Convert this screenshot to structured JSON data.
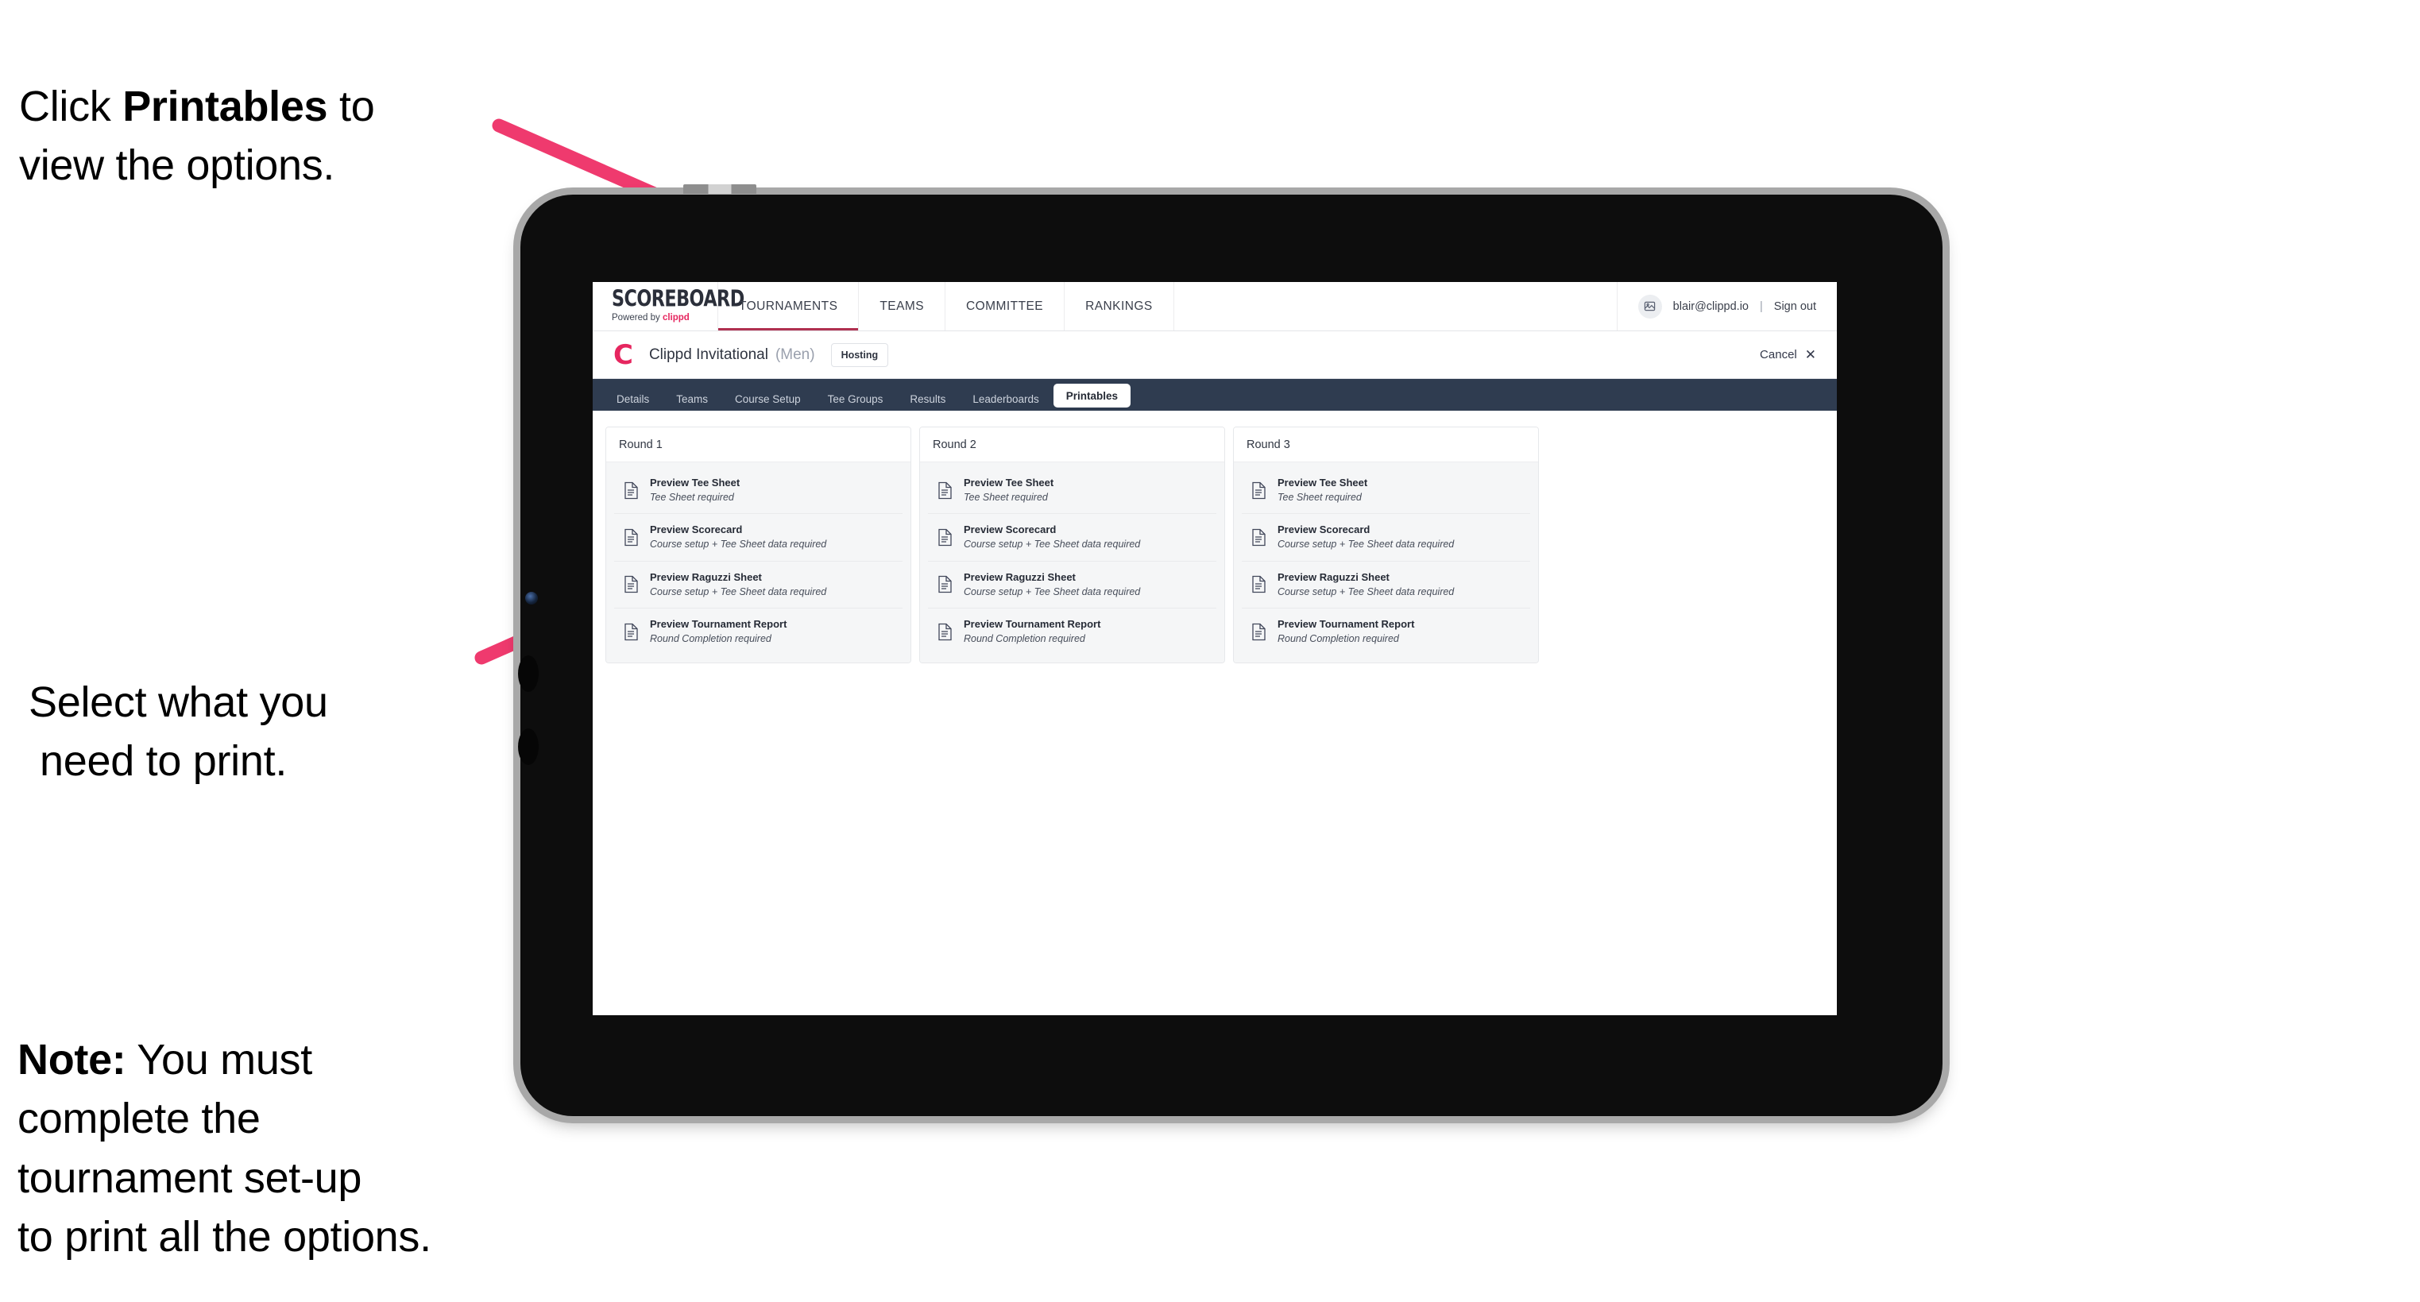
{
  "annotations": {
    "top": {
      "pre": "Click ",
      "bold": "Printables",
      "post": " to\nview the options."
    },
    "middle": {
      "line1": "Select what you",
      "line2": "need to print."
    },
    "note": {
      "bold": "Note:",
      "rest": " You must\ncomplete the\ntournament set-up\nto print all the options."
    }
  },
  "app": {
    "brand": {
      "title": "SCOREBOARD",
      "powered_by": "Powered by ",
      "powered_brand": "clippd"
    },
    "nav": [
      {
        "label": "TOURNAMENTS",
        "active": true
      },
      {
        "label": "TEAMS",
        "active": false
      },
      {
        "label": "COMMITTEE",
        "active": false
      },
      {
        "label": "RANKINGS",
        "active": false
      }
    ],
    "user": {
      "avatar_icon": "user-avatar-icon",
      "email": "blair@clippd.io",
      "separator": "|",
      "sign_out": "Sign out"
    },
    "event": {
      "logo_letter": "C",
      "name": "Clippd Invitational",
      "gender": "(Men)",
      "badge": "Hosting",
      "cancel_label": "Cancel",
      "cancel_icon": "✕"
    },
    "tabs": [
      {
        "label": "Details",
        "active": false
      },
      {
        "label": "Teams",
        "active": false
      },
      {
        "label": "Course Setup",
        "active": false
      },
      {
        "label": "Tee Groups",
        "active": false
      },
      {
        "label": "Results",
        "active": false
      },
      {
        "label": "Leaderboards",
        "active": false
      },
      {
        "label": "Printables",
        "active": true
      }
    ],
    "rounds": [
      {
        "title": "Round 1",
        "items": [
          {
            "title": "Preview Tee Sheet",
            "subtitle": "Tee Sheet required"
          },
          {
            "title": "Preview Scorecard",
            "subtitle": "Course setup + Tee Sheet data required"
          },
          {
            "title": "Preview Raguzzi Sheet",
            "subtitle": "Course setup + Tee Sheet data required"
          },
          {
            "title": "Preview Tournament Report",
            "subtitle": "Round Completion required"
          }
        ]
      },
      {
        "title": "Round 2",
        "items": [
          {
            "title": "Preview Tee Sheet",
            "subtitle": "Tee Sheet required"
          },
          {
            "title": "Preview Scorecard",
            "subtitle": "Course setup + Tee Sheet data required"
          },
          {
            "title": "Preview Raguzzi Sheet",
            "subtitle": "Course setup + Tee Sheet data required"
          },
          {
            "title": "Preview Tournament Report",
            "subtitle": "Round Completion required"
          }
        ]
      },
      {
        "title": "Round 3",
        "items": [
          {
            "title": "Preview Tee Sheet",
            "subtitle": "Tee Sheet required"
          },
          {
            "title": "Preview Scorecard",
            "subtitle": "Course setup + Tee Sheet data required"
          },
          {
            "title": "Preview Raguzzi Sheet",
            "subtitle": "Course setup + Tee Sheet data required"
          },
          {
            "title": "Preview Tournament Report",
            "subtitle": "Round Completion required"
          }
        ]
      }
    ]
  },
  "colors": {
    "accent_pink": "#e6265f",
    "arrow_pink": "#ef3a6e",
    "tabbar_navy": "#2f3c50",
    "tab_active_bg": "#ffffff",
    "card_body_bg": "#f5f6f7",
    "device_body": "#0d0d0d",
    "device_edge": "#a8a8a8"
  }
}
